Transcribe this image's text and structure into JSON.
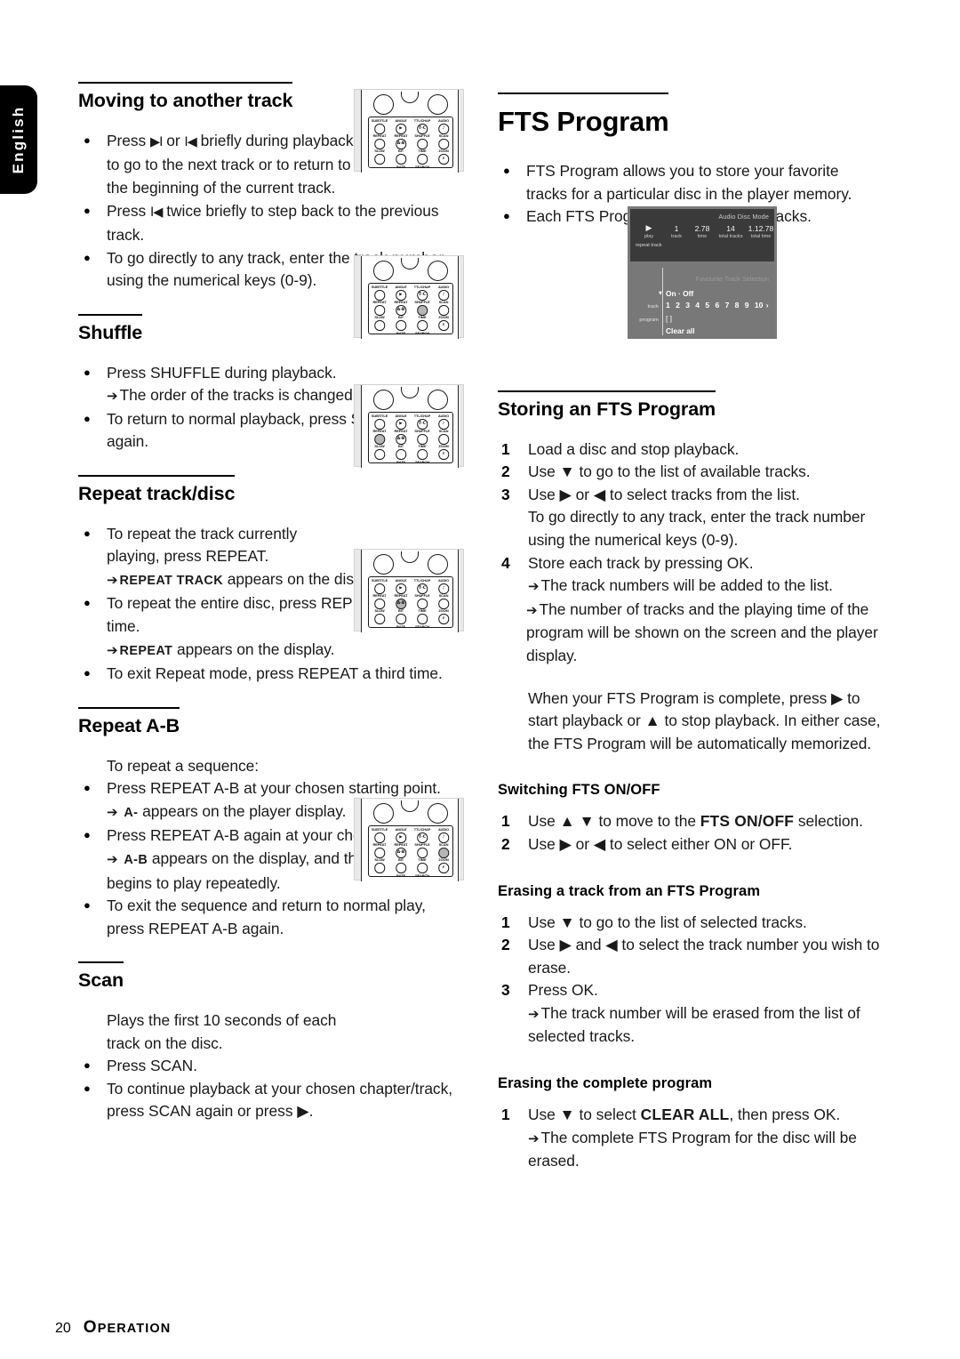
{
  "language_tab": {
    "label": "English"
  },
  "footer": {
    "page_number": "20",
    "section_cap": "O",
    "section_rest": "PERATION"
  },
  "left_column": {
    "sections": [
      {
        "heading": "Moving to another track",
        "items": [
          "Press ▶I or I◀ briefly during playback to go to the next track or to return to the beginning of the current track.",
          "Press I◀ twice briefly to step back to the previous track.",
          "To go directly to any track, enter the track number using the numerical keys (0-9)."
        ]
      },
      {
        "heading": "Shuffle",
        "items": [
          "Press SHUFFLE during playback.",
          "The order of the tracks is changed.",
          "To return to normal playback, press SHUFFLE again."
        ]
      },
      {
        "heading": "Repeat track/disc",
        "items": [
          "To repeat the track currently playing, press REPEAT.",
          "REPEAT TRACK",
          "appears on the display.",
          "To repeat the entire disc, press REPEAT a second time.",
          "REPEAT",
          "appears on the display.",
          "To exit Repeat mode, press REPEAT a third time."
        ]
      },
      {
        "heading": "Repeat A-B",
        "intro": "To repeat a sequence:",
        "items": [
          "Press REPEAT A-B at your chosen starting point.",
          "A-",
          "appears on the player display.",
          "Press REPEAT A-B again at your chosen end point.",
          "A-B",
          "appears on the display, and the sequence begins to play repeatedly.",
          "To exit the sequence and return to normal play, press REPEAT A-B again."
        ]
      },
      {
        "heading": "Scan",
        "intro": "Plays the first 10 seconds of each track on the disc.",
        "items": [
          "Press SCAN.",
          "To continue playback at your chosen chapter/track, press SCAN again or press ▶."
        ]
      }
    ]
  },
  "right_column": {
    "title": "FTS Program",
    "intro_items": [
      "FTS Program allows you to store your favorite tracks for a particular disc in the player memory.",
      "Each FTS Program can contain 20 tracks."
    ],
    "storing": {
      "heading": "Storing an FTS Program",
      "steps": [
        "Load a disc and stop playback.",
        "Use ▼ to go to the list of available tracks.",
        "Use ▶ or ◀ to select tracks from the list.",
        "To go directly to any track, enter the track number using the numerical keys (0-9).",
        "Store each track by pressing OK."
      ],
      "results": [
        "The track numbers will be added to the list.",
        "The number of tracks and the playing time of the program will be shown on the screen and the player display."
      ],
      "note": "When your FTS Program is complete, press ▶ to start playback or ▲ to stop playback. In either case, the FTS Program will be automatically memorized."
    },
    "switching": {
      "heading": "Switching FTS ON/OFF",
      "step1_pre": "Use ▲ ▼ to move to the ",
      "step1_bold": "FTS ON/OFF",
      "step1_post": " selection.",
      "step2": "Use ▶ or ◀ to select either ON or OFF."
    },
    "erasing_track": {
      "heading": "Erasing a track from an FTS Program",
      "steps": [
        "Use ▼ to go to the list of selected tracks.",
        "Use ▶ and ◀ to select the track number you wish to erase.",
        "Press OK."
      ],
      "result": "The track number will be erased from the list of selected tracks."
    },
    "erasing_all": {
      "heading": "Erasing the complete program",
      "step1_pre": "Use ▼ to select ",
      "step1_bold": "CLEAR ALL",
      "step1_post": ", then press OK.",
      "result": "The complete FTS Program for the disc will be erased."
    }
  },
  "osd": {
    "mode_label": "Audio Disc Mode",
    "status": [
      {
        "value": "▶",
        "key": "play"
      },
      {
        "value": "1",
        "key": "track"
      },
      {
        "value": "2.78",
        "key": "time"
      },
      {
        "value": "14",
        "key": "total tracks"
      },
      {
        "value": "1.12.78",
        "key": "total time"
      }
    ],
    "repeat_text": "repeat track",
    "fts_title": "Favourite Track Selection",
    "onoff": "On · Off",
    "track_label": "track",
    "program_label": "program",
    "track_numbers": [
      "1",
      "2",
      "3",
      "4",
      "5",
      "6",
      "7",
      "8",
      "9",
      "10"
    ],
    "more_glyph": "›",
    "program_value": "[ ]",
    "clear_all": "Clear all"
  },
  "remote": {
    "top_labels": [
      "SUBTITLE",
      "ANGLE",
      "TTL/CHAP",
      "AUDIO"
    ],
    "row1_labels": [
      "REPEAT",
      "REPEAT",
      "SHUFFLE",
      "SCAN"
    ],
    "row1_glyphs": [
      "",
      "▶",
      "T·C",
      "♪"
    ],
    "row2_labels": [
      "SLOW",
      "BIT",
      "TIME",
      "ZOOM"
    ],
    "row2_glyphs": [
      "",
      "A-B",
      "",
      ""
    ],
    "row3_labels": [
      "",
      "RATE",
      "SEARCH",
      ""
    ],
    "row3_glyphs": [
      "",
      "",
      "",
      "⌕"
    ],
    "diagrams": [
      {
        "name": "remote-moving-track",
        "highlight": "none"
      },
      {
        "name": "remote-shuffle",
        "highlight": "r2c3"
      },
      {
        "name": "remote-repeat",
        "highlight": "r2c1"
      },
      {
        "name": "remote-repeat-ab",
        "highlight": "r2c2"
      },
      {
        "name": "remote-scan",
        "highlight": "r2c4"
      }
    ]
  }
}
